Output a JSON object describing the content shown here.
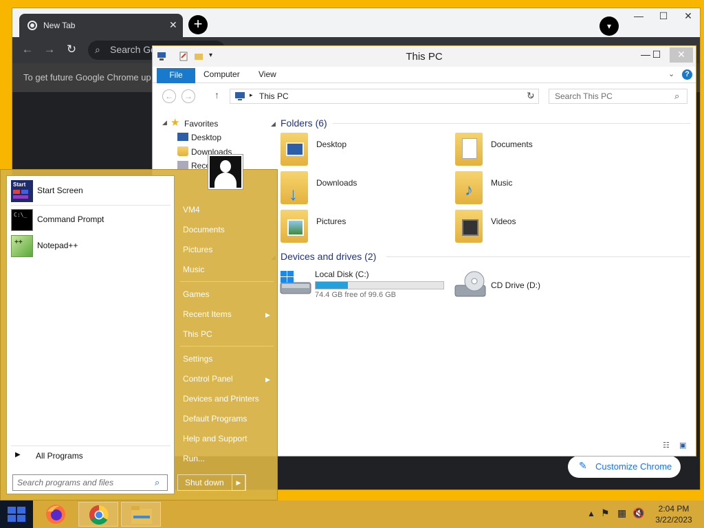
{
  "chrome": {
    "tab_title": "New Tab",
    "omnibox_placeholder": "Search Go",
    "infobar_text": "To get future Google Chrome up",
    "customize_label": "Customize Chrome"
  },
  "explorer": {
    "title": "This PC",
    "ribbon_tabs": [
      "File",
      "Computer",
      "View"
    ],
    "address": "This PC",
    "search_placeholder": "Search This PC",
    "nav": {
      "favorites": "Favorites",
      "items": [
        "Desktop",
        "Downloads",
        "Rece"
      ]
    },
    "folders_header": "Folders (6)",
    "folders": [
      "Desktop",
      "Documents",
      "Downloads",
      "Music",
      "Pictures",
      "Videos"
    ],
    "devices_header": "Devices and drives (2)",
    "devices": [
      {
        "name": "Local Disk (C:)",
        "free": "74.4 GB free of 99.6 GB",
        "used_fraction": 0.253
      },
      {
        "name": "CD Drive (D:)"
      }
    ]
  },
  "startmenu": {
    "programs": [
      "Start Screen",
      "Command Prompt",
      "Notepad++"
    ],
    "all_programs": "All Programs",
    "search_placeholder": "Search programs and files",
    "right_items": [
      "VM4",
      "Documents",
      "Pictures",
      "Music",
      "Games",
      "Recent Items",
      "This PC",
      "Settings",
      "Control Panel",
      "Devices and Printers",
      "Default Programs",
      "Help and Support",
      "Run..."
    ],
    "shutdown_label": "Shut down"
  },
  "taskbar": {
    "time": "2:04 PM",
    "date": "3/22/2023"
  },
  "colors": {
    "accent": "#1979ca",
    "desktop": "#f8b600",
    "taskbar": "#d7a938",
    "startmenu": "#d6b042"
  }
}
